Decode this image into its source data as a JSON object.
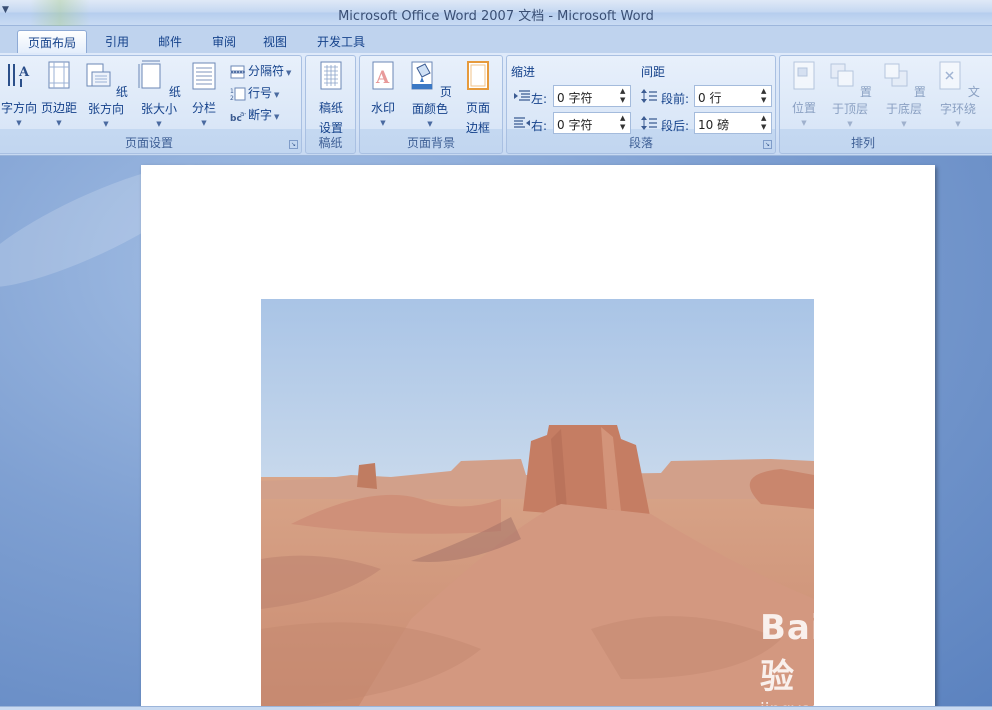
{
  "window": {
    "title": "Microsoft Office Word 2007 文档 - Microsoft Word"
  },
  "tabs": [
    {
      "label": "页面布局",
      "active": true
    },
    {
      "label": "引用"
    },
    {
      "label": "邮件"
    },
    {
      "label": "审阅"
    },
    {
      "label": "视图"
    },
    {
      "label": "开发工具"
    }
  ],
  "groups": {
    "page_setup": {
      "title": "页面设置",
      "text_direction": "字方向",
      "margins": "页边距",
      "orientation": "纸张方向",
      "size": "纸张大小",
      "columns": "分栏",
      "breaks": "分隔符",
      "line_numbers": "行号",
      "hyphenation": "断字"
    },
    "manuscript": {
      "title": "稿纸",
      "setup_line1": "稿纸",
      "setup_line2": "设置"
    },
    "page_background": {
      "title": "页面背景",
      "watermark": "水印",
      "page_color": "页面颜色",
      "borders_line1": "页面",
      "borders_line2": "边框"
    },
    "paragraph": {
      "title": "段落",
      "indent_label": "缩进",
      "indent_left_label": "左:",
      "indent_left_value": "0 字符",
      "indent_right_label": "右:",
      "indent_right_value": "0 字符",
      "spacing_label": "间距",
      "spacing_before_label": "段前:",
      "spacing_before_value": "0 行",
      "spacing_after_label": "段后:",
      "spacing_after_value": "10 磅"
    },
    "arrange": {
      "title": "排列",
      "position": "位置",
      "bring_front": "置于顶层",
      "send_back": "置于底层",
      "text_wrap": "文字环绕"
    }
  },
  "watermark": {
    "logo": "Bai du 经验",
    "url": "jingyan.baidu.com"
  },
  "colors": {
    "ribbon": "#d5e3f6",
    "accent": "#15428b",
    "workspace": "#6f93c8"
  }
}
